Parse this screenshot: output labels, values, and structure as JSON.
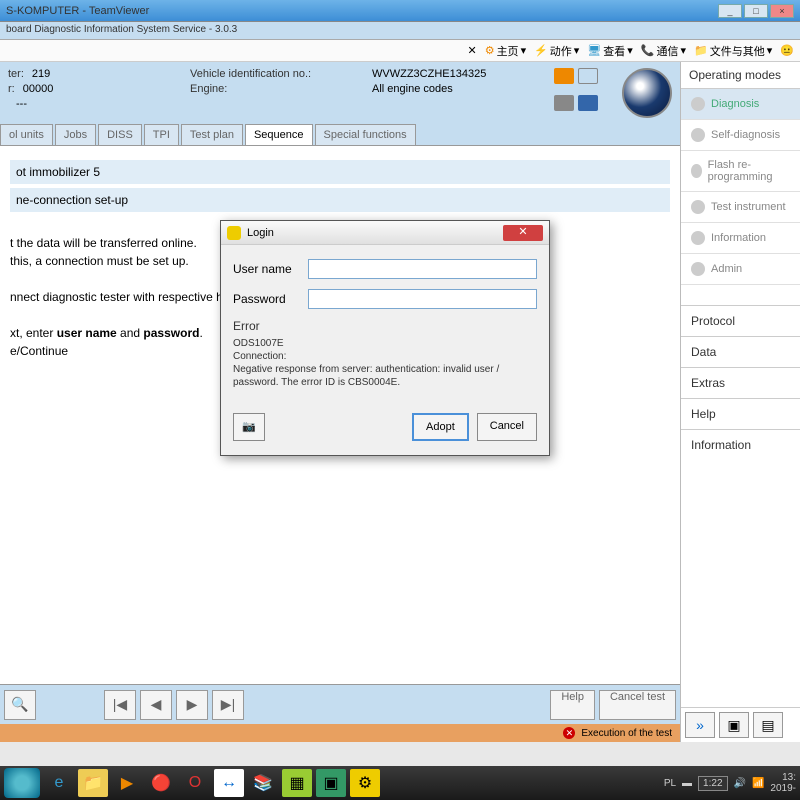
{
  "window": {
    "title": "S-KOMPUTER - TeamViewer",
    "subtitle": "board Diagnostic Information System Service - 3.0.3"
  },
  "toolbar": {
    "home": "主页",
    "action": "动作",
    "view": "查看",
    "comm": "通信",
    "files": "文件与其他"
  },
  "vehicle": {
    "ter_label": "ter:",
    "ter": "219",
    "r_label": "r:",
    "r": "00000",
    "dash": "---",
    "vin_label": "Vehicle identification no.:",
    "vin": "WVWZZ3CZHE134325",
    "engine_label": "Engine:",
    "engine": "All engine codes"
  },
  "tabs": {
    "t1": "ol units",
    "t2": "Jobs",
    "t3": "DISS",
    "t4": "TPI",
    "t5": "Test plan",
    "t6": "Sequence",
    "t7": "Special functions"
  },
  "content": {
    "line1": "ot immobilizer 5",
    "line2": "ne-connection set-up",
    "p1": "t the data will be transferred online.",
    "p2": "this, a connection must be set up.",
    "p3": "nnect diagnostic tester with respective hardware",
    "p4a": "xt, enter ",
    "p4b": "user name",
    "p4c": " and ",
    "p4d": "password",
    "p4e": ".",
    "p5": "e/Continue"
  },
  "bottom": {
    "help": "Help",
    "cancel": "Cancel test"
  },
  "right": {
    "header": "Operating modes",
    "m1": "Diagnosis",
    "m2": "Self-diagnosis",
    "m3": "Flash re-programming",
    "m4": "Test instrument",
    "m5": "Information",
    "m6": "Admin",
    "s1": "Protocol",
    "s2": "Data",
    "s3": "Extras",
    "s4": "Help",
    "s5": "Information"
  },
  "status": {
    "text": "Execution of the test"
  },
  "dialog": {
    "title": "Login",
    "user_label": "User name",
    "pass_label": "Password",
    "err_title": "Error",
    "err_code": "ODS1007E",
    "err_conn": "Connection:",
    "err_msg": "Negative response from server: authentication: invalid user / password. The error ID is CBS0004E.",
    "adopt": "Adopt",
    "cancel": "Cancel"
  },
  "tray": {
    "lang": "PL",
    "battery": "1:22",
    "time": "13:",
    "date": "2019-"
  }
}
